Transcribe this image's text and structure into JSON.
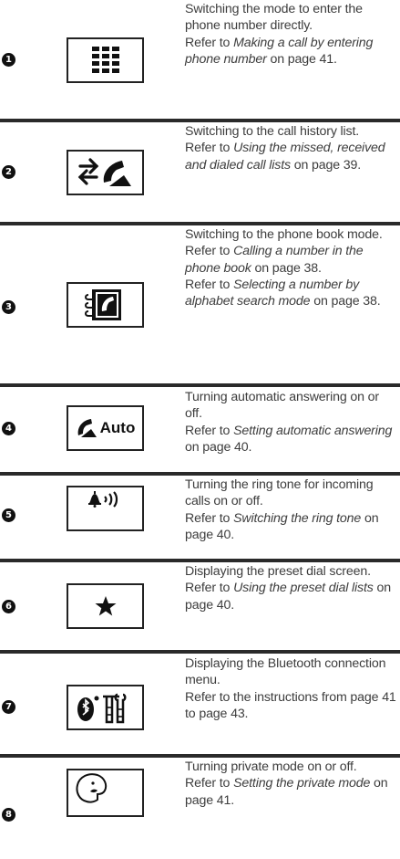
{
  "rows": [
    {
      "number": "1",
      "icon": "keypad-icon",
      "line1": "Switching the mode to enter the phone number directly.",
      "ref_prefix": "Refer to ",
      "ref_title": "Making a call by entering phone number",
      "ref_suffix": " on page 41."
    },
    {
      "number": "2",
      "icon": "call-history-icon",
      "line1": "Switching to the call history list.",
      "ref_prefix": "Refer to ",
      "ref_title": "Using the missed, received and dialed call lists",
      "ref_suffix": " on page 39."
    },
    {
      "number": "3",
      "icon": "phone-book-icon",
      "line1": "Switching to the phone book mode.",
      "ref_prefix": "Refer to ",
      "ref_title": "Calling a number in the phone book",
      "ref_suffix": " on page 38.",
      "ref2_prefix": "Refer to ",
      "ref2_title": "Selecting a number by alphabet search mode",
      "ref2_suffix": " on page 38."
    },
    {
      "number": "4",
      "icon": "auto-answer-icon",
      "icon_text": "Auto",
      "line1": "Turning automatic answering on or off.",
      "ref_prefix": "Refer to ",
      "ref_title": "Setting automatic answering",
      "ref_suffix": " on page 40."
    },
    {
      "number": "5",
      "icon": "ring-tone-icon",
      "line1": "Turning the ring tone for incoming calls on or off.",
      "ref_prefix": "Refer to ",
      "ref_title": "Switching the ring tone",
      "ref_suffix": " on page 40."
    },
    {
      "number": "6",
      "icon": "star-icon",
      "line1": "Displaying the preset dial screen.",
      "ref_prefix": "Refer to ",
      "ref_title": "Using the preset dial lists",
      "ref_suffix": " on page 40."
    },
    {
      "number": "7",
      "icon": "bluetooth-tools-icon",
      "line1": "Displaying the Bluetooth connection menu.",
      "ref_prefix": "Refer to the instructions from page 41 to page 43.",
      "ref_title": "",
      "ref_suffix": ""
    },
    {
      "number": "8",
      "icon": "private-mode-icon",
      "line1": "Turning private mode on or off.",
      "ref_prefix": "Refer to ",
      "ref_title": "Setting the private mode",
      "ref_suffix": " on page 41."
    }
  ]
}
